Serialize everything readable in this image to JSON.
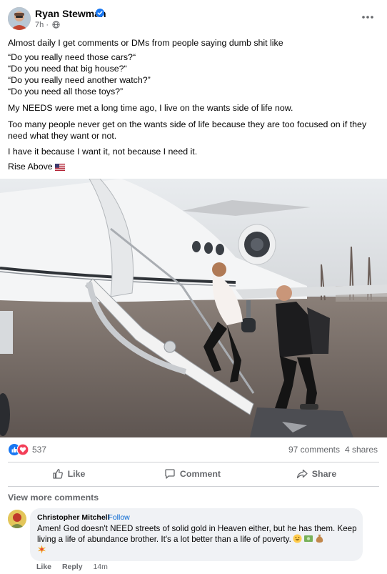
{
  "post": {
    "author": "Ryan Stewman",
    "time": "7h",
    "audience_icon": "globe-icon",
    "paragraphs": [
      "Almost daily I get comments or DMs from people saying dumb shit like",
      "“Do you really need those cars?“",
      "“Do you need that big house?“",
      "“Do you really need another watch?”",
      "“Do you need all those toys?”",
      "My NEEDS were met a long time ago, I live on the wants side of life now.",
      "Too many people never get on the wants side of life because they are too focused on if they need what they want or not.",
      "I have it because I want it, not because I need it.",
      "Rise Above"
    ],
    "flag_icon": "us-flag-icon"
  },
  "stats": {
    "reactions_count": "537",
    "comments": "97 comments",
    "shares": "4 shares"
  },
  "actions": {
    "like": "Like",
    "comment": "Comment",
    "share": "Share"
  },
  "comments_section": {
    "view_more": "View more comments",
    "comment": {
      "name": "Christopher Mitchell",
      "follow": "· Follow",
      "text": "Amen! God doesn't NEED streets of solid gold in Heaven either, but he has them. Keep living a life of abundance brother. It's a lot better than a life of poverty.",
      "emojis": [
        "grinning-face-icon",
        "money-icon",
        "money-bag-icon",
        "sparkle-icon"
      ],
      "like": "Like",
      "reply": "Reply",
      "time": "14m"
    }
  },
  "colors": {
    "brand_blue": "#1877f2",
    "love_red": "#f33e58",
    "muted_text": "#65676b"
  }
}
